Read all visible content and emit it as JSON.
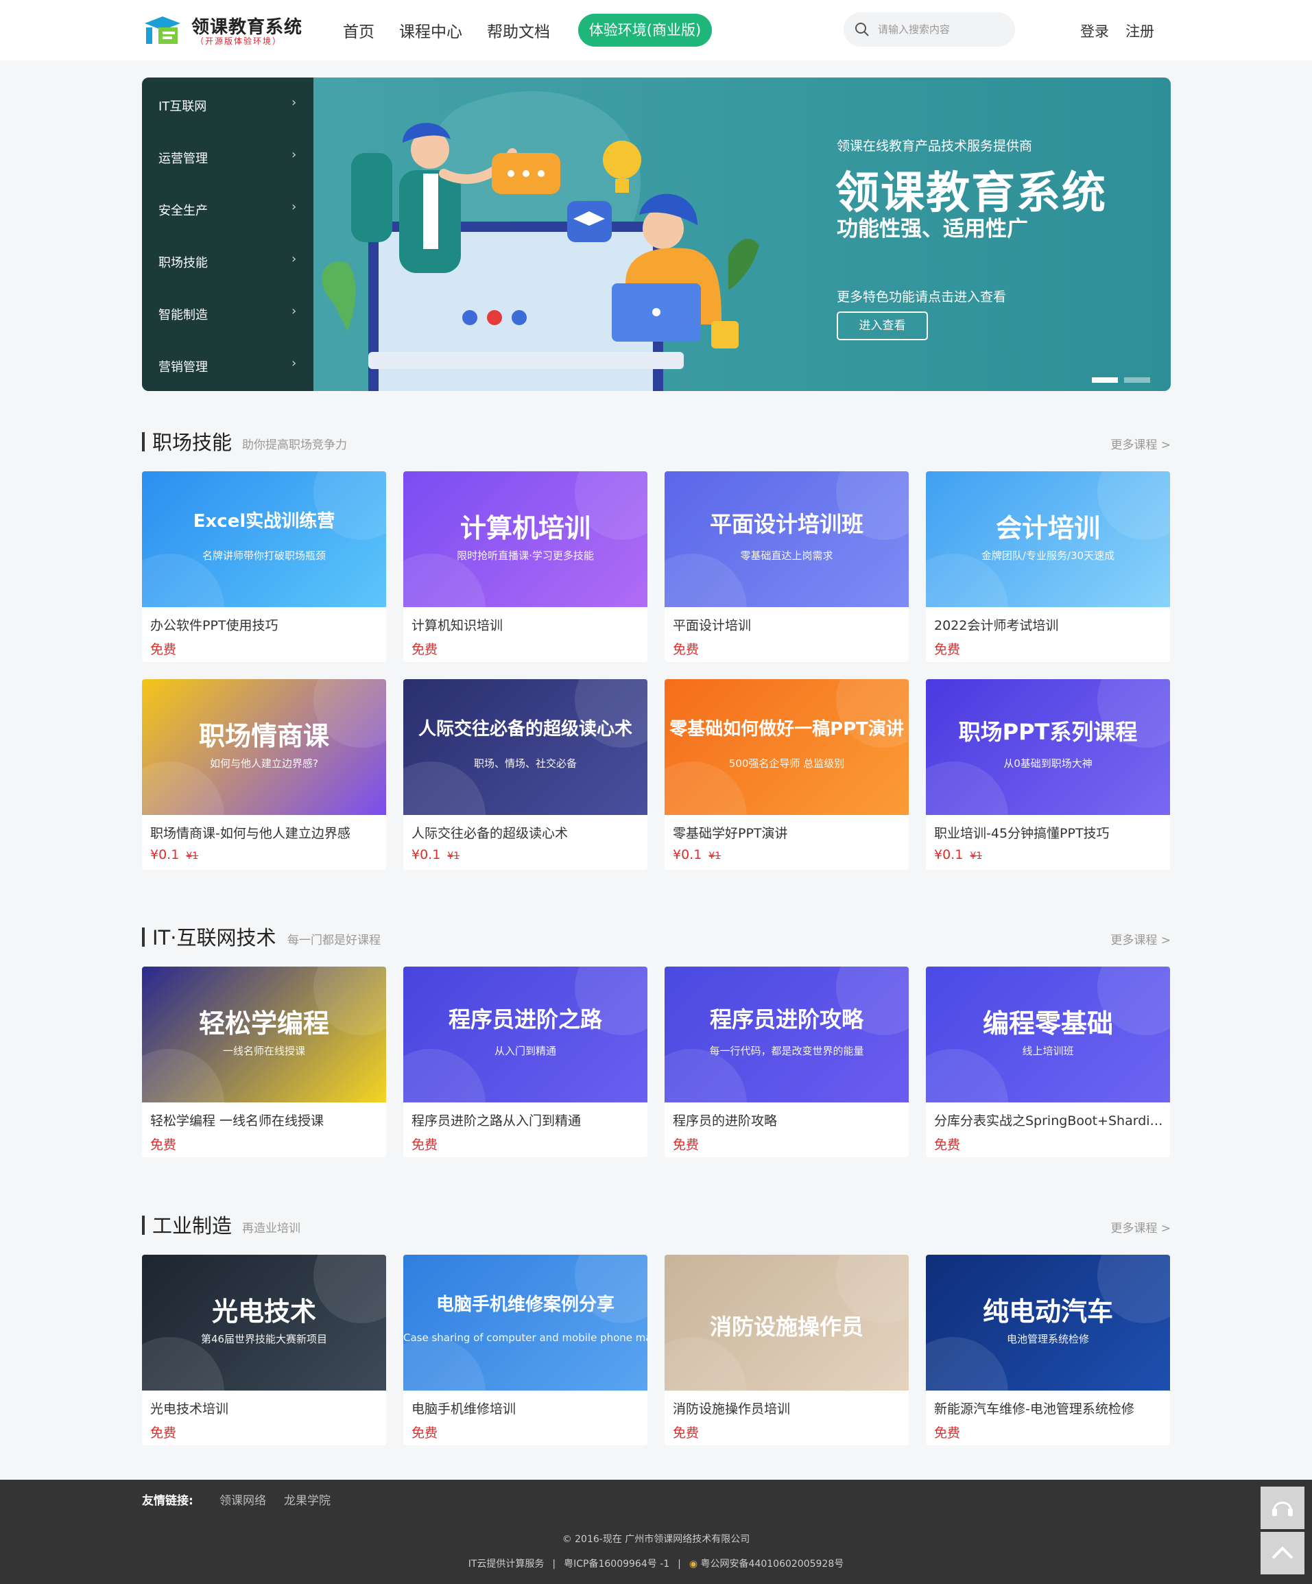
{
  "header": {
    "logo_title": "领课教育系统",
    "logo_sub": "（开源版体验环境）",
    "nav": [
      "首页",
      "课程中心",
      "帮助文档"
    ],
    "trial_label": "体验环境(商业版)",
    "search_placeholder": "请输入搜索内容",
    "login": "登录",
    "register": "注册"
  },
  "categories": [
    {
      "label": "IT互联网"
    },
    {
      "label": "运营管理"
    },
    {
      "label": "安全生产"
    },
    {
      "label": "职场技能"
    },
    {
      "label": "智能制造"
    },
    {
      "label": "营销管理"
    }
  ],
  "banner": {
    "tagline": "领课在线教育产品技术服务提供商",
    "title": "领课教育系统",
    "subtitle": "功能性强、适用性广",
    "more": "更多特色功能请点击进入查看",
    "button": "进入查看"
  },
  "sections": [
    {
      "title": "职场技能",
      "subtitle": "助你提高职场竞争力",
      "more": "更多课程 >",
      "courses": [
        {
          "title": "办公软件PPT使用技巧",
          "price": "免费",
          "orig": "",
          "img_text": "Excel实战训练营",
          "img_sub": "名牌讲师带你打破职场瓶颈",
          "color1": "#2b8ff0",
          "color2": "#5dc5fb"
        },
        {
          "title": "计算机知识培训",
          "price": "免费",
          "orig": "",
          "img_text": "计算机培训",
          "img_sub": "限时抢听直播课·学习更多技能",
          "color1": "#7b4df2",
          "color2": "#b06cf5"
        },
        {
          "title": "平面设计培训",
          "price": "免费",
          "orig": "",
          "img_text": "平面设计培训班",
          "img_sub": "零基础直达上岗需求",
          "color1": "#5b67e8",
          "color2": "#7d8cf5"
        },
        {
          "title": "2022会计师考试培训",
          "price": "免费",
          "orig": "",
          "img_text": "会计培训",
          "img_sub": "金牌团队/专业服务/30天速成",
          "color1": "#3fa0f2",
          "color2": "#8ad3fb"
        },
        {
          "title": "职场情商课-如何与他人建立边界感",
          "price": "¥0.1",
          "orig": "¥1",
          "img_text": "职场情商课",
          "img_sub": "如何与他人建立边界感?",
          "color1": "#f5c518",
          "color2": "#7a4df0"
        },
        {
          "title": "人际交往必备的超级读心术",
          "price": "¥0.1",
          "orig": "¥1",
          "img_text": "人际交往必备的超级读心术",
          "img_sub": "职场、情场、社交必备",
          "color1": "#2a2f6e",
          "color2": "#4a4f9e"
        },
        {
          "title": "零基础学好PPT演讲",
          "price": "¥0.1",
          "orig": "¥1",
          "img_text": "零基础如何做好一稿PPT演讲",
          "img_sub": "500强名企导师 总监级别",
          "color1": "#f56d1b",
          "color2": "#fb9c35"
        },
        {
          "title": "职业培训-45分钟搞懂PPT技巧",
          "price": "¥0.1",
          "orig": "¥1",
          "img_text": "职场PPT系列课程",
          "img_sub": "从0基础到职场大神",
          "color1": "#4a3ae0",
          "color2": "#7868f2"
        }
      ]
    },
    {
      "title": "IT·互联网技术",
      "subtitle": "每一门都是好课程",
      "more": "更多课程 >",
      "courses": [
        {
          "title": "轻松学编程 一线名师在线授课",
          "price": "免费",
          "orig": "",
          "img_text": "轻松学编程",
          "img_sub": "一线名师在线授课",
          "color1": "#2a2a8e",
          "color2": "#f5d523"
        },
        {
          "title": "程序员进阶之路从入门到精通",
          "price": "免费",
          "orig": "",
          "img_text": "程序员进阶之路",
          "img_sub": "从入门到精通",
          "color1": "#4845dd",
          "color2": "#6a5ff0"
        },
        {
          "title": "程序员的进阶攻略",
          "price": "免费",
          "orig": "",
          "img_text": "程序员进阶攻略",
          "img_sub": "每一行代码，都是改变世界的能量",
          "color1": "#4a4ae0",
          "color2": "#6b5cf0"
        },
        {
          "title": "分库分表实战之SpringBoot+Shardin...",
          "price": "免费",
          "orig": "",
          "img_text": "编程零基础",
          "img_sub": "线上培训班",
          "color1": "#4a4ae6",
          "color2": "#6e64f2"
        }
      ]
    },
    {
      "title": "工业制造",
      "subtitle": "再造业培训",
      "more": "更多课程 >",
      "courses": [
        {
          "title": "光电技术培训",
          "price": "免费",
          "orig": "",
          "img_text": "光电技术",
          "img_sub": "第46届世界技能大赛新项目",
          "color1": "#1c2530",
          "color2": "#3e4a58"
        },
        {
          "title": "电脑手机维修培训",
          "price": "免费",
          "orig": "",
          "img_text": "电脑手机维修案例分享",
          "img_sub": "Case sharing of computer and mobile phone maintenance",
          "color1": "#2f7fe0",
          "color2": "#5aa4f0"
        },
        {
          "title": "消防设施操作员培训",
          "price": "免费",
          "orig": "",
          "img_text": "消防设施操作员",
          "img_sub": "",
          "color1": "#c9b49a",
          "color2": "#e3d3bf"
        },
        {
          "title": "新能源汽车维修-电池管理系统检修",
          "price": "免费",
          "orig": "",
          "img_text": "纯电动汽车",
          "img_sub": "电池管理系统检修",
          "color1": "#0f2f7a",
          "color2": "#1e4fb0"
        }
      ]
    }
  ],
  "footer": {
    "friend_label": "友情链接:",
    "links": [
      "领课网络",
      "龙果学院"
    ],
    "copyright": "© 2016-现在 广州市领课网络技术有限公司",
    "cloud": "IT云提供计算服务",
    "icp": "粤ICP备16009964号 -1",
    "police": "粤公网安备44010602005928号"
  },
  "colors": {
    "accent": "#1fb67a",
    "price": "#e52a2a",
    "menu_bg": "#1c3b38",
    "banner_bg": "#3c9aa1",
    "footer_bg": "#343434"
  },
  "icons": [
    "logo-icon",
    "search-icon",
    "chevron-right-icon",
    "headset-icon",
    "back-to-top-icon",
    "police-badge-icon"
  ]
}
